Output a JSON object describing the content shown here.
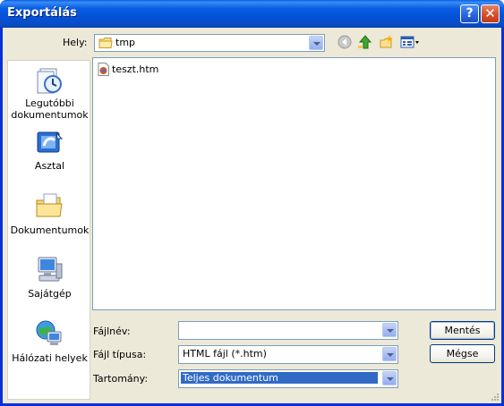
{
  "window": {
    "title": "Exportálás"
  },
  "titlebar": {
    "help_label": "?",
    "close_label": "✕"
  },
  "location": {
    "label": "Hely:",
    "value": "tmp",
    "icons": [
      "back-icon",
      "up-folder-icon",
      "new-folder-icon",
      "views-menu-icon"
    ]
  },
  "places": [
    {
      "label": "Legutóbbi dokumentumok",
      "icon": "recent-documents-icon"
    },
    {
      "label": "Asztal",
      "icon": "desktop-icon"
    },
    {
      "label": "Dokumentumok",
      "icon": "my-documents-icon"
    },
    {
      "label": "Sajátgép",
      "icon": "my-computer-icon"
    },
    {
      "label": "Hálózati helyek",
      "icon": "network-places-icon"
    }
  ],
  "files": [
    {
      "name": "teszt.htm",
      "icon": "html-file-icon"
    }
  ],
  "form": {
    "filename_label": "Fájlnév:",
    "filename_value": "",
    "filetype_label": "Fájl típusa:",
    "filetype_value": "HTML fájl (*.htm)",
    "range_label": "Tartomány:",
    "range_value": "Teljes dokumentum"
  },
  "buttons": {
    "save": "Mentés",
    "cancel": "Mégse"
  },
  "colors": {
    "titlebar": "#0a5ee4",
    "client": "#ece9d8",
    "selection": "#316ac5",
    "close": "#d9512c"
  }
}
